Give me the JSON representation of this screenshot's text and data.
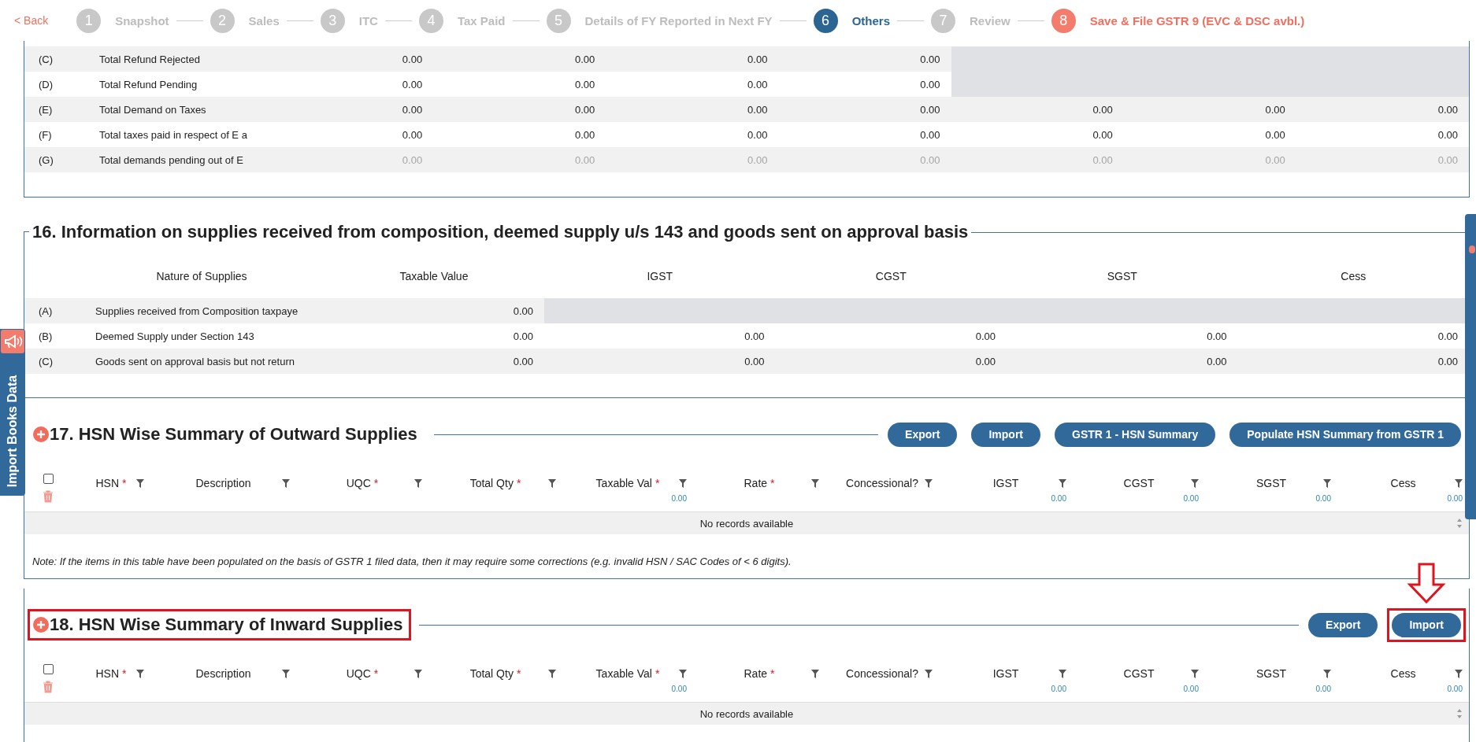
{
  "stepper": {
    "back": "< Back",
    "steps": [
      {
        "number": "1",
        "label": "Snapshot",
        "kind": "step",
        "selected": false
      },
      {
        "number": "2",
        "label": "Sales",
        "kind": "step",
        "selected": false
      },
      {
        "number": "3",
        "label": "ITC",
        "kind": "step",
        "selected": false
      },
      {
        "number": "4",
        "label": "Tax Paid",
        "kind": "step",
        "selected": false
      },
      {
        "number": "5",
        "label": "Details of FY Reported in Next FY",
        "kind": "step",
        "selected": false
      },
      {
        "number": "6",
        "label": "Others",
        "kind": "step",
        "selected": true
      },
      {
        "number": "7",
        "label": "Review",
        "kind": "step",
        "selected": false
      },
      {
        "number": "8",
        "label": "Save & File GSTR 9 (EVC & DSC avbl.)",
        "kind": "file",
        "selected": false
      }
    ]
  },
  "side_tab": {
    "label": "Import Books Data"
  },
  "refund_table": {
    "rows": [
      {
        "code": "(C)",
        "label": "Total Refund Rejected",
        "muted": false,
        "values": [
          "0.00",
          "0.00",
          "0.00",
          "0.00"
        ]
      },
      {
        "code": "(D)",
        "label": "Total Refund Pending",
        "muted": false,
        "values": [
          "0.00",
          "0.00",
          "0.00",
          "0.00"
        ]
      },
      {
        "code": "(E)",
        "label": "Total Demand on Taxes",
        "muted": false,
        "values": [
          "0.00",
          "0.00",
          "0.00",
          "0.00",
          "0.00",
          "0.00",
          "0.00"
        ]
      },
      {
        "code": "(F)",
        "label": "Total taxes paid in respect of E a",
        "muted": false,
        "values": [
          "0.00",
          "0.00",
          "0.00",
          "0.00",
          "0.00",
          "0.00",
          "0.00"
        ]
      },
      {
        "code": "(G)",
        "label": "Total demands pending out of E",
        "muted": true,
        "values": [
          "0.00",
          "0.00",
          "0.00",
          "0.00",
          "0.00",
          "0.00",
          "0.00"
        ]
      }
    ]
  },
  "section_16": {
    "title": "16. Information on supplies received from composition, deemed supply u/s 143 and goods sent on approval basis",
    "columns": [
      "Nature of Supplies",
      "Taxable Value",
      "IGST",
      "CGST",
      "SGST",
      "Cess"
    ],
    "rows": [
      {
        "code": "(A)",
        "label": "Supplies received from Composition taxpaye",
        "values": [
          "0.00"
        ]
      },
      {
        "code": "(B)",
        "label": "Deemed Supply under Section 143",
        "values": [
          "0.00",
          "0.00",
          "0.00",
          "0.00",
          "0.00"
        ]
      },
      {
        "code": "(C)",
        "label": "Goods sent on approval basis but not return",
        "values": [
          "0.00",
          "0.00",
          "0.00",
          "0.00",
          "0.00"
        ]
      }
    ]
  },
  "section_17": {
    "title": "17. HSN Wise Summary of Outward Supplies",
    "highlighted": false,
    "buttons": [
      {
        "label": "Export",
        "highlighted": false
      },
      {
        "label": "Import",
        "highlighted": false
      },
      {
        "label": "GSTR 1 - HSN Summary",
        "highlighted": false
      },
      {
        "label": "Populate HSN Summary from GSTR 1",
        "highlighted": false
      }
    ],
    "select_all": {
      "checked": false
    },
    "columns": [
      {
        "label": "HSN",
        "marker": "*"
      },
      {
        "label": "Description"
      },
      {
        "label": "UQC",
        "marker": "*"
      },
      {
        "label": "Total Qty",
        "marker": "*"
      },
      {
        "label": "Taxable Val",
        "marker": "*",
        "total": "0.00"
      },
      {
        "label": "Rate",
        "marker": "*"
      },
      {
        "label": "Concessional?"
      },
      {
        "label": "IGST",
        "total": "0.00"
      },
      {
        "label": "CGST",
        "total": "0.00"
      },
      {
        "label": "SGST",
        "total": "0.00"
      },
      {
        "label": "Cess",
        "total": "0.00"
      }
    ],
    "empty_text": "No records available",
    "note": "Note: If the items in this table have been populated on the basis of GSTR 1 filed data, then it may require some corrections (e.g. invalid HSN / SAC Codes of < 6 digits)."
  },
  "section_18": {
    "title": "18. HSN Wise Summary of Inward Supplies",
    "highlighted": true,
    "buttons": [
      {
        "label": "Export",
        "highlighted": false
      },
      {
        "label": "Import",
        "highlighted": true
      }
    ],
    "select_all": {
      "checked": false
    },
    "columns": [
      {
        "label": "HSN",
        "marker": "*"
      },
      {
        "label": "Description"
      },
      {
        "label": "UQC",
        "marker": "*"
      },
      {
        "label": "Total Qty",
        "marker": "*"
      },
      {
        "label": "Taxable Val",
        "marker": "*",
        "total": "0.00"
      },
      {
        "label": "Rate",
        "marker": "*"
      },
      {
        "label": "Concessional?"
      },
      {
        "label": "IGST",
        "total": "0.00"
      },
      {
        "label": "CGST",
        "total": "0.00"
      },
      {
        "label": "SGST",
        "total": "0.00"
      },
      {
        "label": "Cess",
        "total": "0.00"
      }
    ],
    "empty_text": "No records available"
  }
}
